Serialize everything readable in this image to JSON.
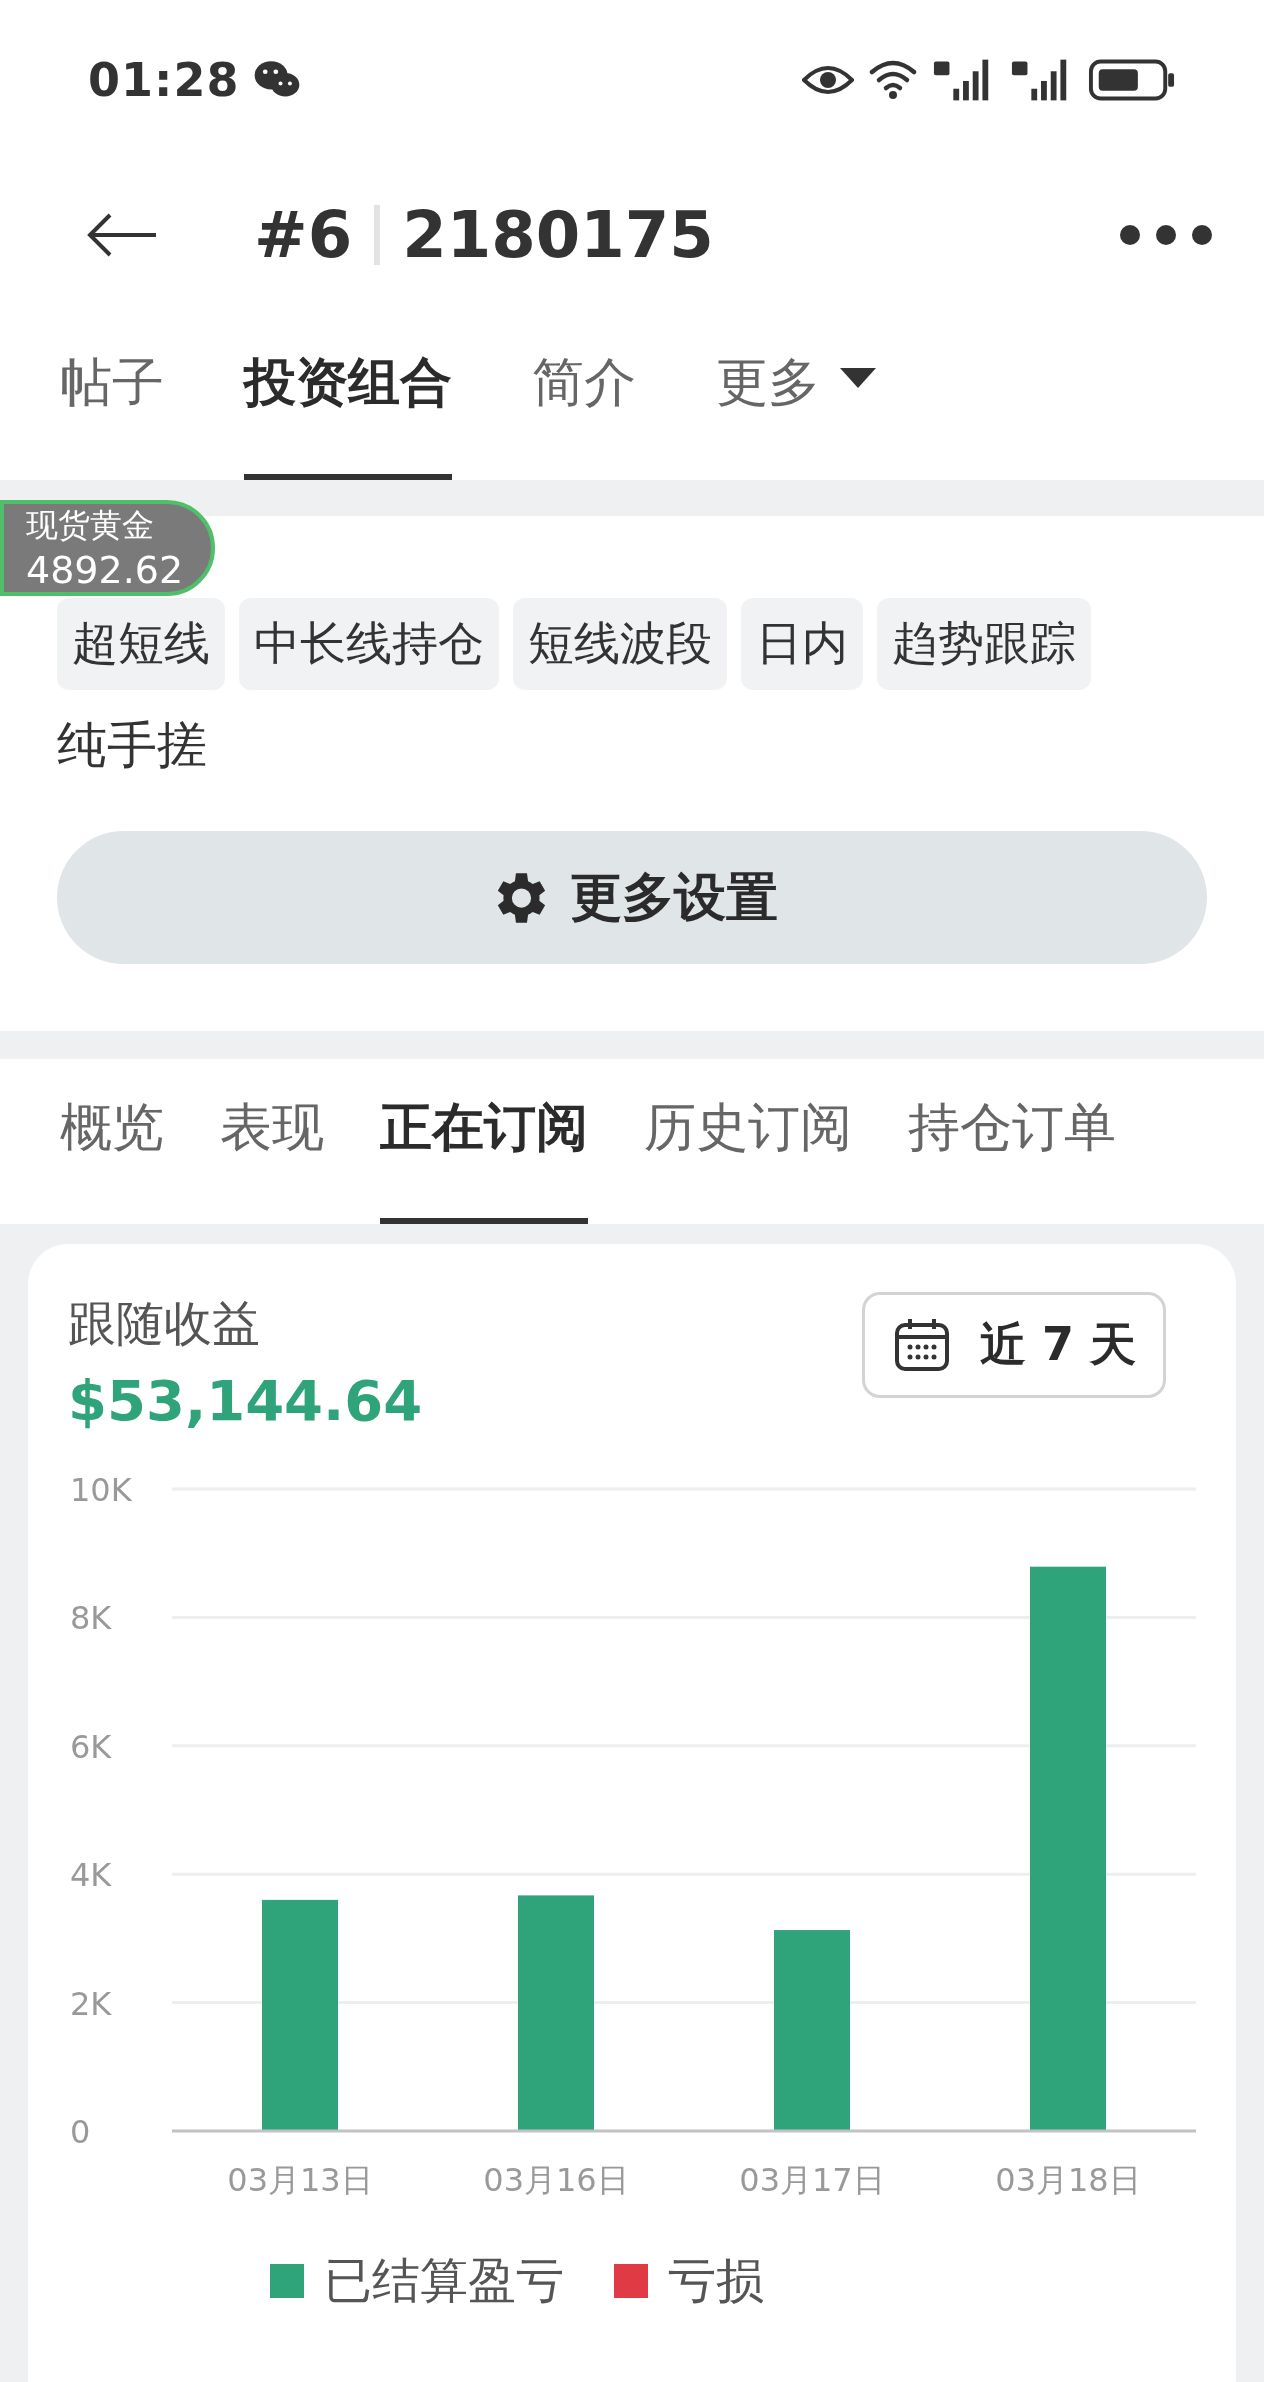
{
  "status_bar": {
    "time": "01:28"
  },
  "header": {
    "rank": "#6",
    "account": "2180175"
  },
  "tabs": [
    {
      "label": "帖子",
      "selected": false
    },
    {
      "label": "投资组合",
      "selected": true
    },
    {
      "label": "简介",
      "selected": false
    },
    {
      "label": "更多",
      "selected": false,
      "dropdown": true
    }
  ],
  "price_widget": {
    "name": "现货黄金",
    "price": "4892.62"
  },
  "tags": [
    "超短线",
    "中长线持仓",
    "短线波段",
    "日内",
    "趋势跟踪"
  ],
  "strategy_note": "纯手搓",
  "settings_button": "更多设置",
  "sub_tabs": [
    {
      "label": "概览",
      "selected": false
    },
    {
      "label": "表现",
      "selected": false
    },
    {
      "label": "正在订阅",
      "selected": true
    },
    {
      "label": "历史订阅",
      "selected": false
    },
    {
      "label": "持仓订单",
      "selected": false
    }
  ],
  "earnings": {
    "title": "跟随收益",
    "amount": "$53,144.64",
    "period": "近 7 天",
    "chart_data": {
      "type": "bar",
      "categories": [
        "03月13日",
        "03月16日",
        "03月17日",
        "03月18日"
      ],
      "series": [
        {
          "name": "已结算盈亏",
          "color": "#2fa37a",
          "values": [
            3600,
            3670,
            3130,
            8790
          ]
        },
        {
          "name": "亏损",
          "color": "#e03a45",
          "values": [
            null,
            null,
            null,
            null
          ]
        }
      ],
      "ylim": [
        0,
        10000
      ],
      "grid": true,
      "yticks": [
        {
          "value": 0,
          "label": "0"
        },
        {
          "value": 2000,
          "label": "2K"
        },
        {
          "value": 4000,
          "label": "4K"
        },
        {
          "value": 6000,
          "label": "6K"
        },
        {
          "value": 8000,
          "label": "8K"
        },
        {
          "value": 10000,
          "label": "10K"
        }
      ]
    }
  }
}
